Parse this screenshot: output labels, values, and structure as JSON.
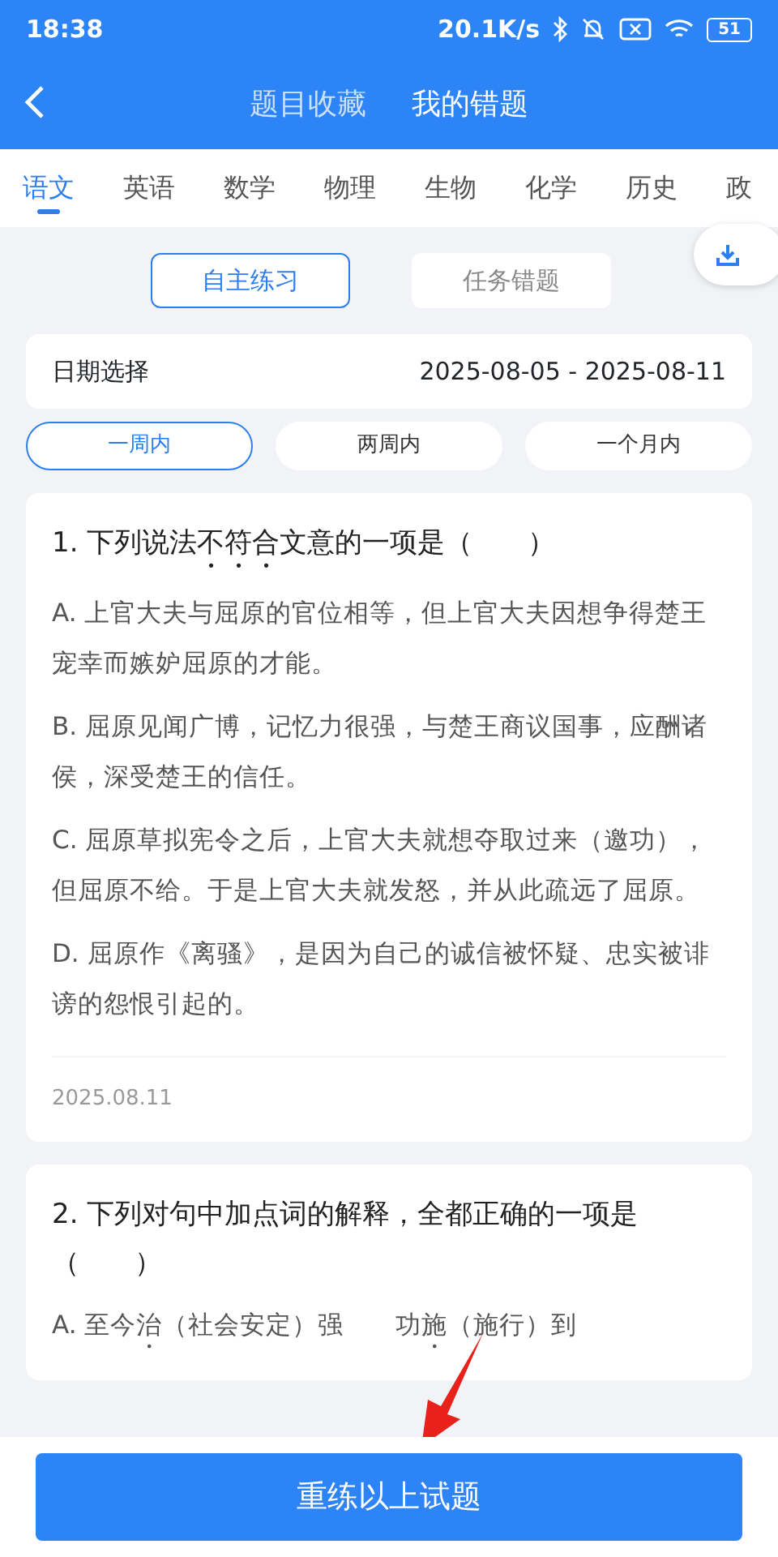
{
  "status_bar": {
    "time": "18:38",
    "speed": "20.1K/s",
    "battery": "51"
  },
  "header": {
    "tabs": [
      {
        "label": "题目收藏",
        "selected": false
      },
      {
        "label": "我的错题",
        "selected": true
      }
    ]
  },
  "subjects": [
    {
      "label": "语文",
      "selected": true
    },
    {
      "label": "英语",
      "selected": false
    },
    {
      "label": "数学",
      "selected": false
    },
    {
      "label": "物理",
      "selected": false
    },
    {
      "label": "生物",
      "selected": false
    },
    {
      "label": "化学",
      "selected": false
    },
    {
      "label": "历史",
      "selected": false
    },
    {
      "label": "政",
      "selected": false
    }
  ],
  "modes": [
    {
      "label": "自主练习",
      "selected": true
    },
    {
      "label": "任务错题",
      "selected": false
    }
  ],
  "date_filter": {
    "label": "日期选择",
    "range": "2025-08-05 - 2025-08-11"
  },
  "periods": [
    {
      "label": "一周内",
      "selected": true
    },
    {
      "label": "两周内",
      "selected": false
    },
    {
      "label": "一个月内",
      "selected": false
    }
  ],
  "questions": [
    {
      "stem": "1.  下列说法**不符合**文意的一项是（　　）",
      "options": [
        "A. 上官大夫与屈原的官位相等，但上官大夫因想争得楚王宠幸而嫉妒屈原的才能。",
        "B. 屈原见闻广博，记忆力很强，与楚王商议国事，应酬诸侯，深受楚王的信任。",
        "C. 屈原草拟宪令之后，上官大夫就想夺取过来（邀功），但屈原不给。于是上官大夫就发怒，并从此疏远了屈原。",
        "D. 屈原作《离骚》，是因为自己的诚信被怀疑、忠实被诽谤的怨恨引起的。"
      ],
      "date": "2025.08.11"
    },
    {
      "stem": "2.  下列对句中加点词的解释，全都正确的一项是（　　）",
      "options": [
        "A. 至今**治**（社会安定）强　　功**施**（施行）到"
      ]
    }
  ],
  "footer": {
    "button": "重练以上试题"
  }
}
